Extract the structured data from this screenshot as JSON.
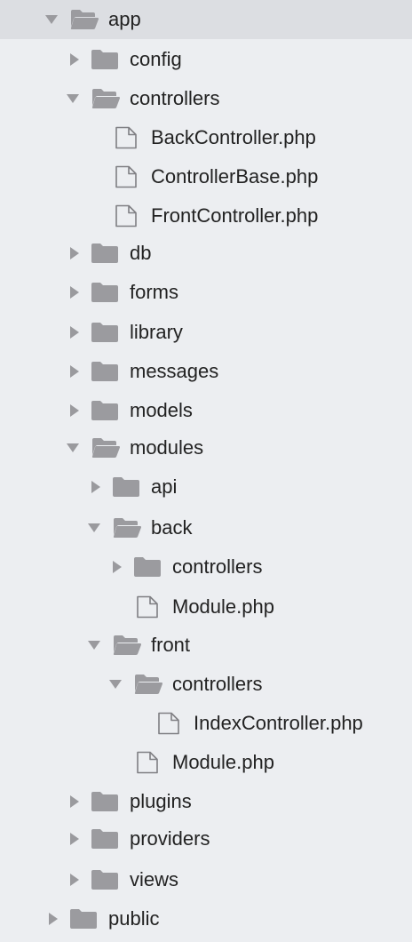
{
  "tree": {
    "items": [
      {
        "label": "app",
        "kind": "folder",
        "expanded": true,
        "selected": true
      },
      {
        "label": "config",
        "kind": "folder",
        "expanded": false
      },
      {
        "label": "controllers",
        "kind": "folder",
        "expanded": true
      },
      {
        "label": "BackController.php",
        "kind": "file"
      },
      {
        "label": "ControllerBase.php",
        "kind": "file"
      },
      {
        "label": "FrontController.php",
        "kind": "file"
      },
      {
        "label": "db",
        "kind": "folder",
        "expanded": false
      },
      {
        "label": "forms",
        "kind": "folder",
        "expanded": false
      },
      {
        "label": "library",
        "kind": "folder",
        "expanded": false
      },
      {
        "label": "messages",
        "kind": "folder",
        "expanded": false
      },
      {
        "label": "models",
        "kind": "folder",
        "expanded": false
      },
      {
        "label": "modules",
        "kind": "folder",
        "expanded": true
      },
      {
        "label": "api",
        "kind": "folder",
        "expanded": false
      },
      {
        "label": "back",
        "kind": "folder",
        "expanded": true
      },
      {
        "label": "controllers",
        "kind": "folder",
        "expanded": false
      },
      {
        "label": "Module.php",
        "kind": "file"
      },
      {
        "label": "front",
        "kind": "folder",
        "expanded": true
      },
      {
        "label": "controllers",
        "kind": "folder",
        "expanded": true
      },
      {
        "label": "IndexController.php",
        "kind": "file"
      },
      {
        "label": "Module.php",
        "kind": "file"
      },
      {
        "label": "plugins",
        "kind": "folder",
        "expanded": false
      },
      {
        "label": "providers",
        "kind": "folder",
        "expanded": false
      },
      {
        "label": "views",
        "kind": "folder",
        "expanded": false
      },
      {
        "label": "public",
        "kind": "folder",
        "expanded": false
      }
    ]
  },
  "colors": {
    "background": "#eceef1",
    "selected_row": "#dcdee2",
    "icon_gray": "#9b9b9f",
    "arrow_gray": "#9a9a9e",
    "text": "#222222"
  }
}
